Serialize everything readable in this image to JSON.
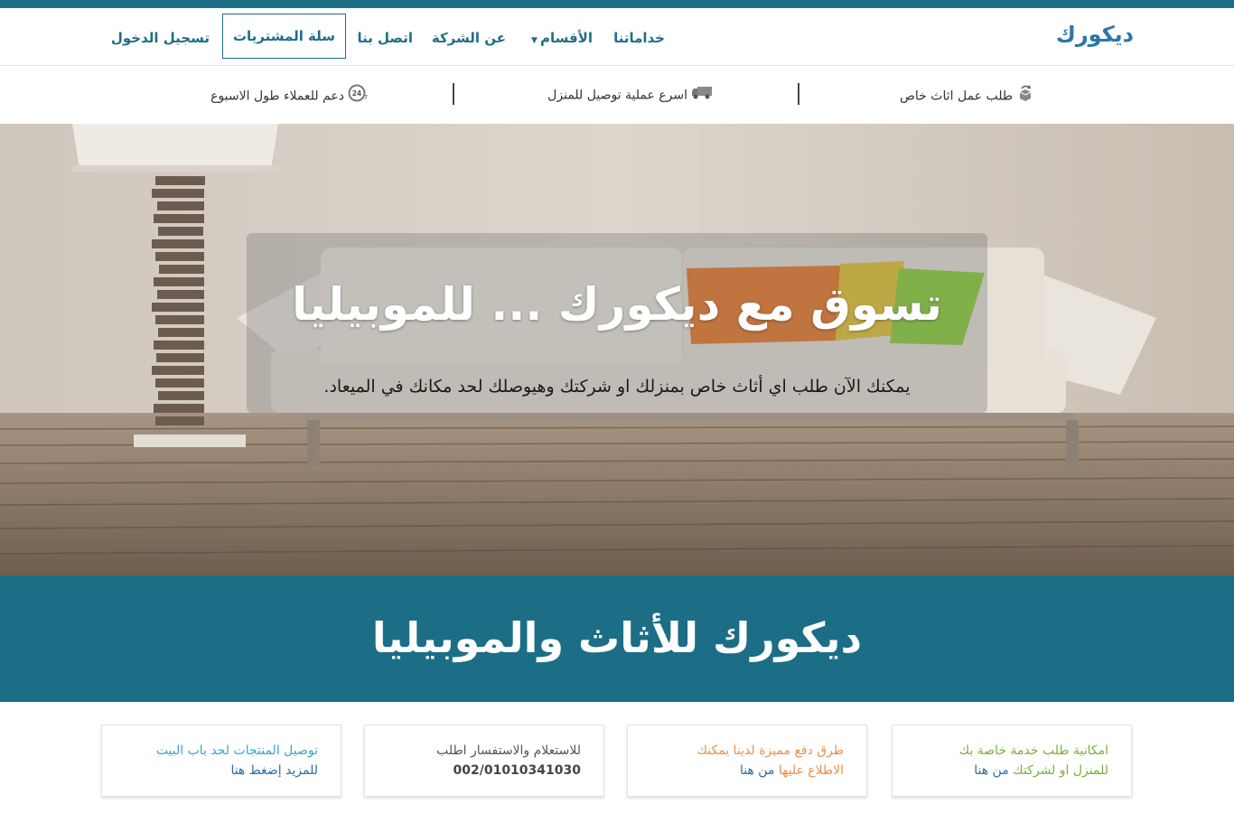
{
  "brand": "ديكورك",
  "nav": {
    "services": "خداماتنا",
    "categories": "الأقسام",
    "about": "عن الشركة",
    "contact": "اتصل بنا",
    "cart": "سلة المشتريات",
    "login": "تسجيل الدخول"
  },
  "features": [
    {
      "label": "طلب عمل اثاث خاص",
      "icon": "refresh-box-icon"
    },
    {
      "label": "اسرع عملية توصيل للمنزل",
      "icon": "truck-icon"
    },
    {
      "label": "دعم للعملاء طول الاسبوع",
      "icon": "support-24-7-icon"
    }
  ],
  "hero": {
    "title": "تسوق مع ديكورك ... للموبيليا",
    "subtitle": "يمكنك الآن طلب اي أثاث خاص بمنزلك او شركتك وهيوصلك لحد مكانك في الميعاد."
  },
  "band": {
    "title": "ديكورك للأثاث والموبيليا"
  },
  "cards": [
    {
      "line1": "امكانية طلب خدمة خاصة بك",
      "line2a": "للمنزل او لشركتك",
      "line2b": "من هنا",
      "color1": "#7cae3e",
      "color2a": "#7cae3e",
      "color2b": "#2a6ea8"
    },
    {
      "line1": "طرق دفع مميزة لدينا يمكنك",
      "line2a": "الاطلاع عليها",
      "line2b": "من هنا",
      "color1": "#e8914a",
      "color2a": "#e8914a",
      "color2b": "#2a6ea8"
    },
    {
      "line1": "للاستعلام والاستفسار اطلب",
      "line2a": "002/01010341030",
      "line2b": "",
      "color1": "#555555",
      "color2a": "#444444",
      "color2b": "#444444"
    },
    {
      "line1": "توصيل المنتجات لحد باب البيت",
      "line2a": "للمزيد إضغط هنا",
      "line2b": "",
      "color1": "#3aa6c4",
      "color2a": "#2a6ea8",
      "color2b": "#2a6ea8"
    }
  ],
  "colors": {
    "primary": "#1e6f86",
    "band": "#1b6e85",
    "brand": "#2a78a8"
  }
}
